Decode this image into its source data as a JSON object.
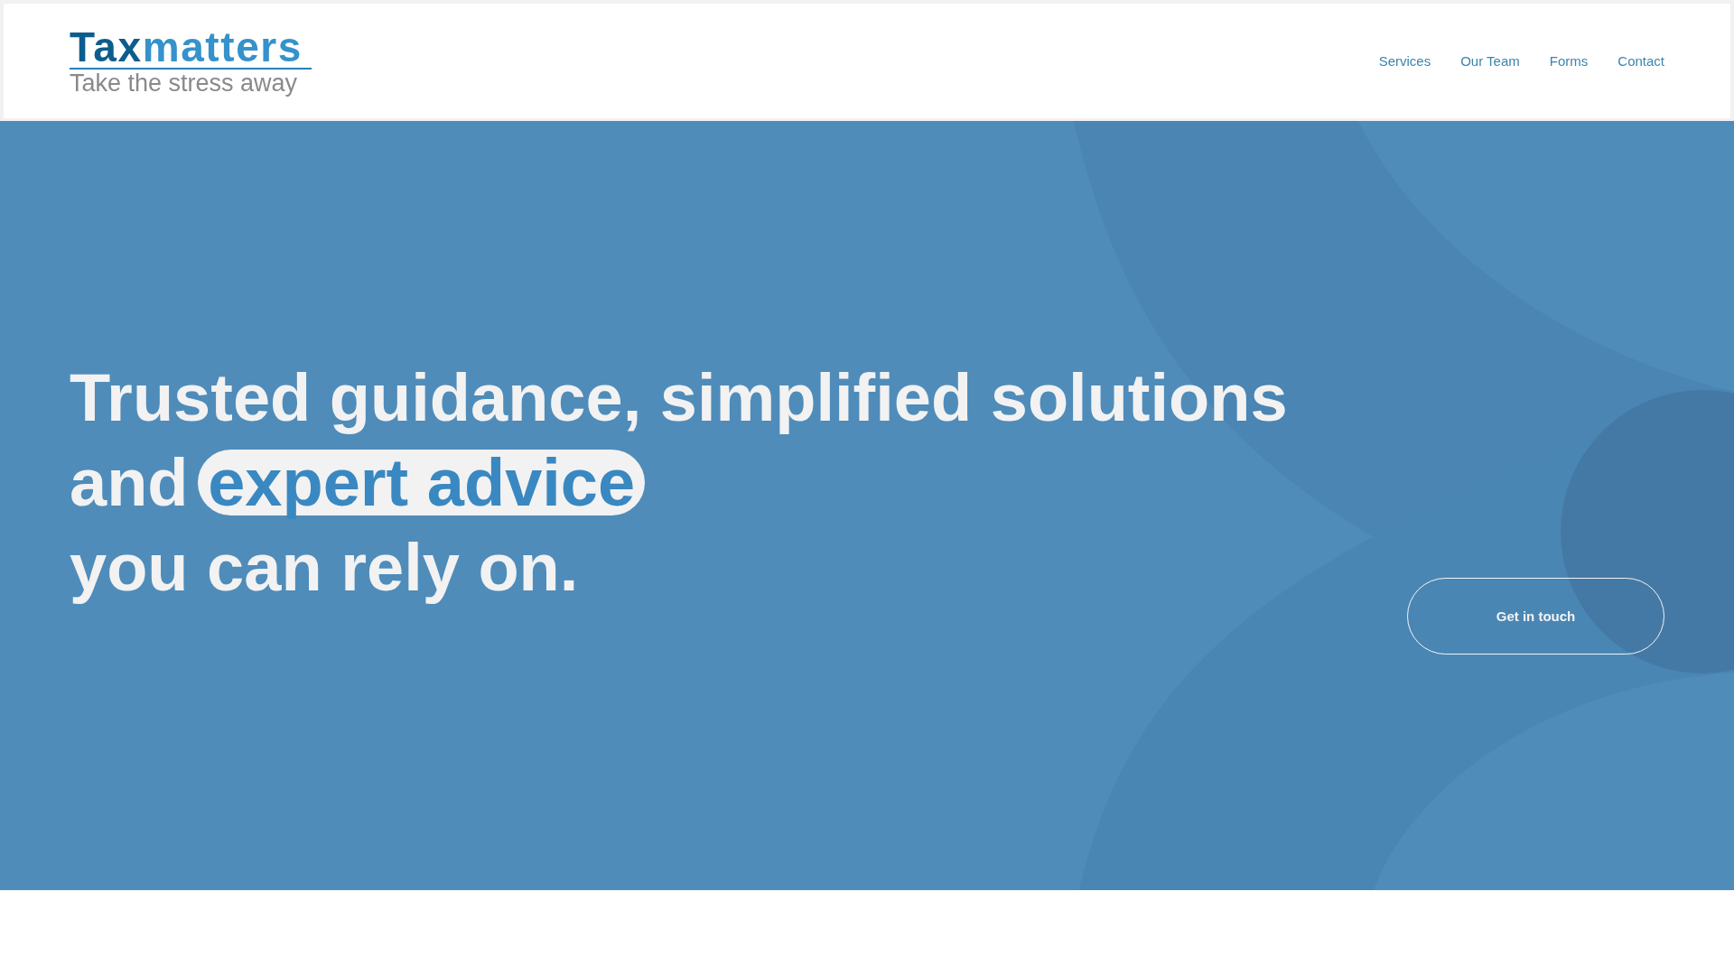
{
  "header": {
    "logo": {
      "brand_lead": "Tax",
      "brand_rest": "matters",
      "tagline": "Take the stress away"
    },
    "nav": [
      {
        "label": "Services"
      },
      {
        "label": "Our Team"
      },
      {
        "label": "Forms"
      },
      {
        "label": "Contact"
      }
    ]
  },
  "hero": {
    "headline": {
      "lead": "Trusted guidance, simplified solutions and",
      "highlight": "expert advice",
      "tail": "you can rely on."
    },
    "cta_button": {
      "label": "Get in touch"
    }
  }
}
